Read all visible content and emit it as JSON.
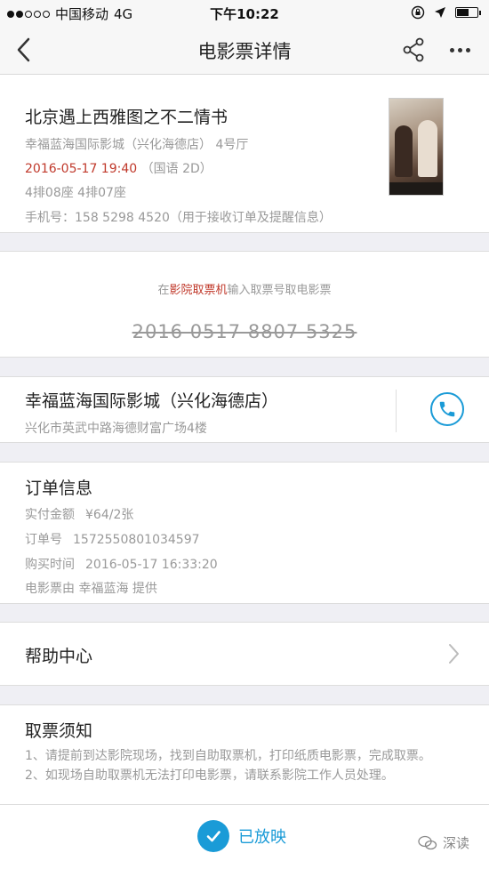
{
  "status_bar": {
    "carrier": "中国移动",
    "network": "4G",
    "time": "下午10:22"
  },
  "nav": {
    "title": "电影票详情",
    "icons": [
      "back-arrow-icon",
      "share-icon",
      "more-icon"
    ]
  },
  "movie": {
    "name": "北京遇上西雅图之不二情书",
    "cinema_hall": "幸福蓝海国际影城（兴化海德店） 4号厅",
    "showtime": "2016-05-17 19:40",
    "language": "（国语 2D）",
    "seats": "4排08座 4排07座",
    "phone": "手机号：158 5298 4520（用于接收订单及提醒信息）"
  },
  "code_section": {
    "hint_prefix": "在",
    "hint_highlight": "影院取票机",
    "hint_suffix": "输入取票号取电影票",
    "code": "2016 0517 8807 5325"
  },
  "cinema": {
    "name": "幸福蓝海国际影城（兴化海德店）",
    "address": "兴化市英武中路海德财富广场4楼"
  },
  "order": {
    "title": "订单信息",
    "paid_label": "实付金额",
    "paid_value": "¥64/2张",
    "order_no_label": "订单号",
    "order_no_value": "1572550801034597",
    "purchase_time_label": "购买时间",
    "purchase_time_value": "2016-05-17 16:33:20",
    "provider": "电影票由 幸福蓝海 提供"
  },
  "help": {
    "title": "帮助中心"
  },
  "notice": {
    "title": "取票须知",
    "item1": "1、请提前到达影院现场，找到自助取票机，打印纸质电影票，完成取票。",
    "item2": "2、如现场自助取票机无法打印电影票，请联系影院工作人员处理。"
  },
  "bottom": {
    "status_label": "已放映",
    "watermark": "深读"
  },
  "colors": {
    "accent": "#1a9bd7",
    "highlight": "#c0392b"
  }
}
